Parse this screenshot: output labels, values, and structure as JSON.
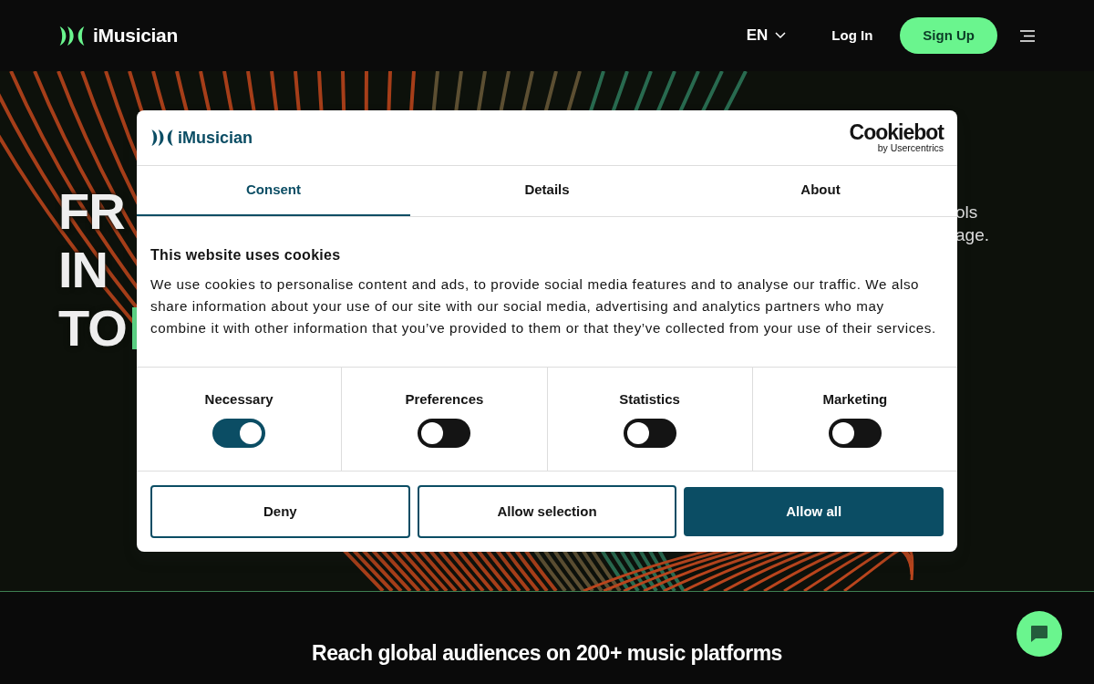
{
  "navbar": {
    "brand": "iMusician",
    "language": "EN",
    "login": "Log In",
    "signup": "Sign Up"
  },
  "hero": {
    "headline_fragments": [
      "FR",
      "IN",
      "TO"
    ],
    "side_fragments": [
      "ols",
      "age."
    ]
  },
  "cookie_dialog": {
    "brand": "iMusician",
    "provider": "Cookiebot",
    "provider_sub": "by Usercentrics",
    "tabs": [
      {
        "label": "Consent",
        "selected": true
      },
      {
        "label": "Details",
        "selected": false
      },
      {
        "label": "About",
        "selected": false
      }
    ],
    "heading": "This website uses cookies",
    "text": "We use cookies to personalise content and ads, to provide social media features and to analyse our traffic. We also share information about your use of our site with our social media, advertising and analytics partners who may combine it with other information that you’ve provided to them or that they’ve collected from your use of their services.",
    "categories": [
      {
        "label": "Necessary",
        "on": true
      },
      {
        "label": "Preferences",
        "on": false
      },
      {
        "label": "Statistics",
        "on": false
      },
      {
        "label": "Marketing",
        "on": false
      }
    ],
    "buttons": [
      {
        "label": "Deny",
        "kind": "outline"
      },
      {
        "label": "Allow selection",
        "kind": "outline"
      },
      {
        "label": "Allow all",
        "kind": "filled"
      }
    ]
  },
  "section": {
    "heading": "Reach global audiences on 200+ music platforms"
  }
}
